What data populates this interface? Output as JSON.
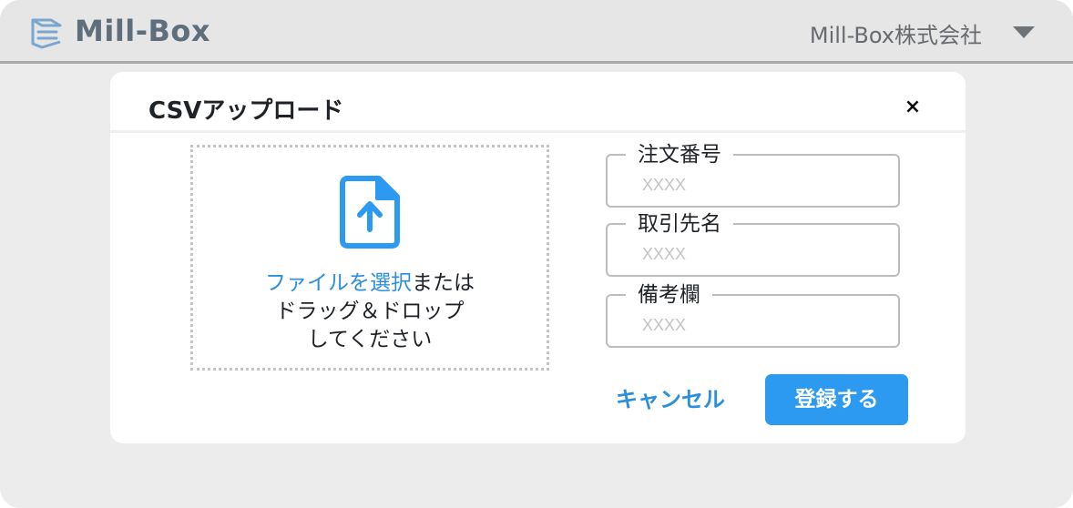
{
  "header": {
    "logo_icon": "stacked-boxes-logo-icon",
    "logo_text": "Mill-Box",
    "company_name": "Mill-Box株式会社",
    "dropdown_icon": "caret-down-icon"
  },
  "modal": {
    "title": "CSVアップロード",
    "close_label": "×",
    "dropzone": {
      "icon": "file-upload-icon",
      "link_text": "ファイルを選択",
      "text_line1_rest": "または",
      "text_line2": "ドラッグ＆ドロップ",
      "text_line3": "してください"
    },
    "fields": [
      {
        "label": "注文番号",
        "placeholder": "XXXX",
        "value": ""
      },
      {
        "label": "取引先名",
        "placeholder": "XXXX",
        "value": ""
      },
      {
        "label": "備考欄",
        "placeholder": "XXXX",
        "value": ""
      }
    ],
    "cancel_label": "キャンセル",
    "submit_label": "登録する"
  },
  "colors": {
    "accent": "#2b9af0",
    "link": "#2d8fdc",
    "background": "#ececec",
    "header_text": "#5f6e7c"
  }
}
